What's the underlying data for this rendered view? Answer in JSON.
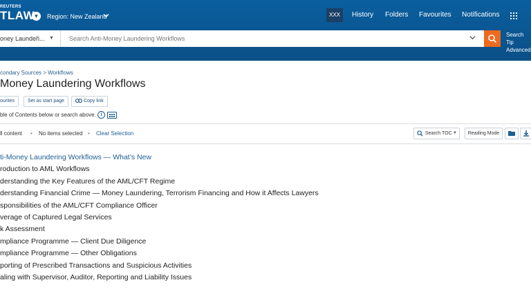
{
  "header": {
    "brand_small": "REUTERS",
    "brand": "TLAW",
    "region_label": "Region: New Zealand",
    "nav": [
      "XXX",
      "History",
      "Folders",
      "Favourites",
      "Notifications"
    ]
  },
  "search": {
    "scope_value": "oney Laundeři...",
    "placeholder": "Search Anti-Money Laundering Workflows",
    "tips_line1": "Search Tip",
    "tips_line2": "Advanced"
  },
  "breadcrumb": "condary Sources > Workflows",
  "title": "Money Laundering Workflows",
  "actions": {
    "favourites": "ourites",
    "set_start": "Set as start page",
    "copy_link": "Copy link"
  },
  "toc_hint": "ble of Contents below or search above.",
  "selection_bar": {
    "all_content": "ll content",
    "no_items": "No items selected",
    "clear": "Clear Selection"
  },
  "tools": {
    "search_toc": "Search TOC",
    "reading_mode": "Reading Mode"
  },
  "toc_items": [
    "ti-Money Laundering Workflows — What’s New",
    "roduction to AML Workflows",
    "derstanding the Key Features of the AML/CFT Regime",
    "derstanding Financial Crime — Money Laundering, Terrorism Financing and How it Affects Lawyers",
    "sponsibilities of the AML/CFT Compliance Officer",
    "verage of Captured Legal Services",
    "k Assessment",
    "mpliance Programme — Client Due Diligence",
    "mpliance Programme — Other Obligations",
    "porting of Prescribed Transactions and Suspicious Activities",
    "aling with Supervisor, Auditor, Reporting and Liability Issues"
  ],
  "colors": {
    "header_blue": "#0b5a94",
    "search_orange": "#ee6a1f",
    "link_blue": "#1d5e93"
  },
  "icons": [
    "apps-grid-icon",
    "chevron-down-icon",
    "search-icon",
    "info-icon",
    "keyboard-icon",
    "link-icon",
    "folder-icon",
    "download-icon"
  ]
}
